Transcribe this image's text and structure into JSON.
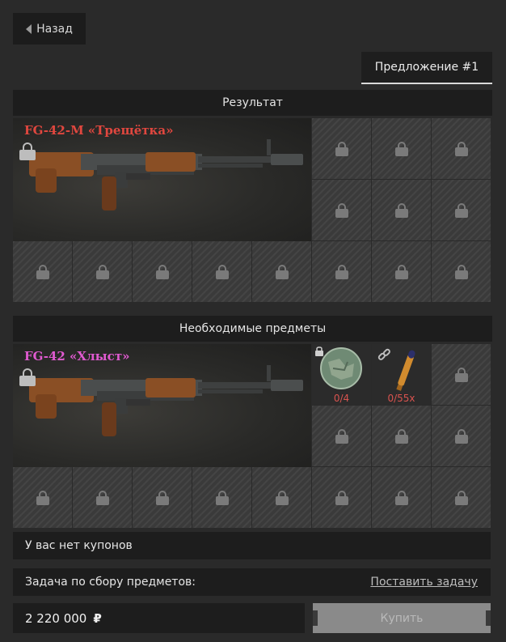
{
  "nav": {
    "back_label": "Назад"
  },
  "offer_tab": {
    "label": "Предложение #1"
  },
  "result": {
    "header": "Результат",
    "weapon_name": "FG-42-M «Трещётка»",
    "weapon_name_color": "#e0473f"
  },
  "required": {
    "header": "Необходимые предметы",
    "weapon_name": "FG-42 «Хлыст»",
    "weapon_name_color": "#e05ad0",
    "items": [
      {
        "icon": "map-item-icon",
        "count": "0/4"
      },
      {
        "icon": "ammo-item-icon",
        "count": "0/55x"
      }
    ]
  },
  "coupons": {
    "text": "У вас нет купонов"
  },
  "task": {
    "label": "Задача по сбору предметов:",
    "link": "Поставить задачу"
  },
  "purchase": {
    "price": "2 220 000",
    "currency": "₽",
    "buy_label": "Купить"
  }
}
